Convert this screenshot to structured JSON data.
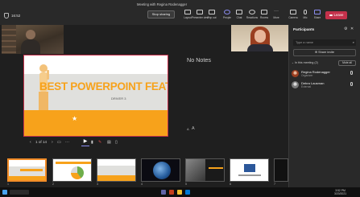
{
  "window": {
    "title": "Meeting with Regina Rodenagger",
    "clock": "16:52"
  },
  "toolbar": {
    "stop_sharing": "Stop sharing",
    "items": [
      {
        "label": "Layout",
        "icon": "layout-icon"
      },
      {
        "label": "Presenter view",
        "icon": "presenter-view-icon"
      },
      {
        "label": "Pop out",
        "icon": "pop-out-icon"
      },
      {
        "label": "People",
        "icon": "people-icon"
      },
      {
        "label": "Chat",
        "icon": "chat-icon"
      },
      {
        "label": "Reactions",
        "icon": "reactions-icon"
      },
      {
        "label": "Rooms",
        "icon": "rooms-icon"
      },
      {
        "label": "More",
        "icon": "more-icon"
      },
      {
        "label": "Camera",
        "icon": "camera-icon"
      },
      {
        "label": "Mic",
        "icon": "mic-icon"
      },
      {
        "label": "Share",
        "icon": "share-icon"
      }
    ],
    "leave": "Leave",
    "accent": "#8b8cf0",
    "leave_color": "#c4314b"
  },
  "slide": {
    "headline": "BEST POWERPOINT FEATURES",
    "subtitle": "DRIVER 3",
    "accent": "#f7a21b"
  },
  "notes": {
    "empty_text": "No Notes",
    "zoom_out": "A",
    "zoom_in": "A"
  },
  "presenter_controls": {
    "page": "1 of 14"
  },
  "thumbnails": [
    {
      "num": "1"
    },
    {
      "num": "2"
    },
    {
      "num": "3"
    },
    {
      "num": "4"
    },
    {
      "num": "5"
    },
    {
      "num": "6"
    },
    {
      "num": "7"
    }
  ],
  "participants": {
    "title": "Participants",
    "search_placeholder": "Type a name",
    "share_invite": "Share invite",
    "section": "In this meeting (2)",
    "mute_all": "Mute all",
    "people": [
      {
        "name": "Regina Rodenagger",
        "role": "Organizer"
      },
      {
        "name": "Debra Lausman",
        "role": "External"
      }
    ]
  },
  "taskbar": {
    "time": "3:52 PM",
    "date": "3/20/2021"
  }
}
